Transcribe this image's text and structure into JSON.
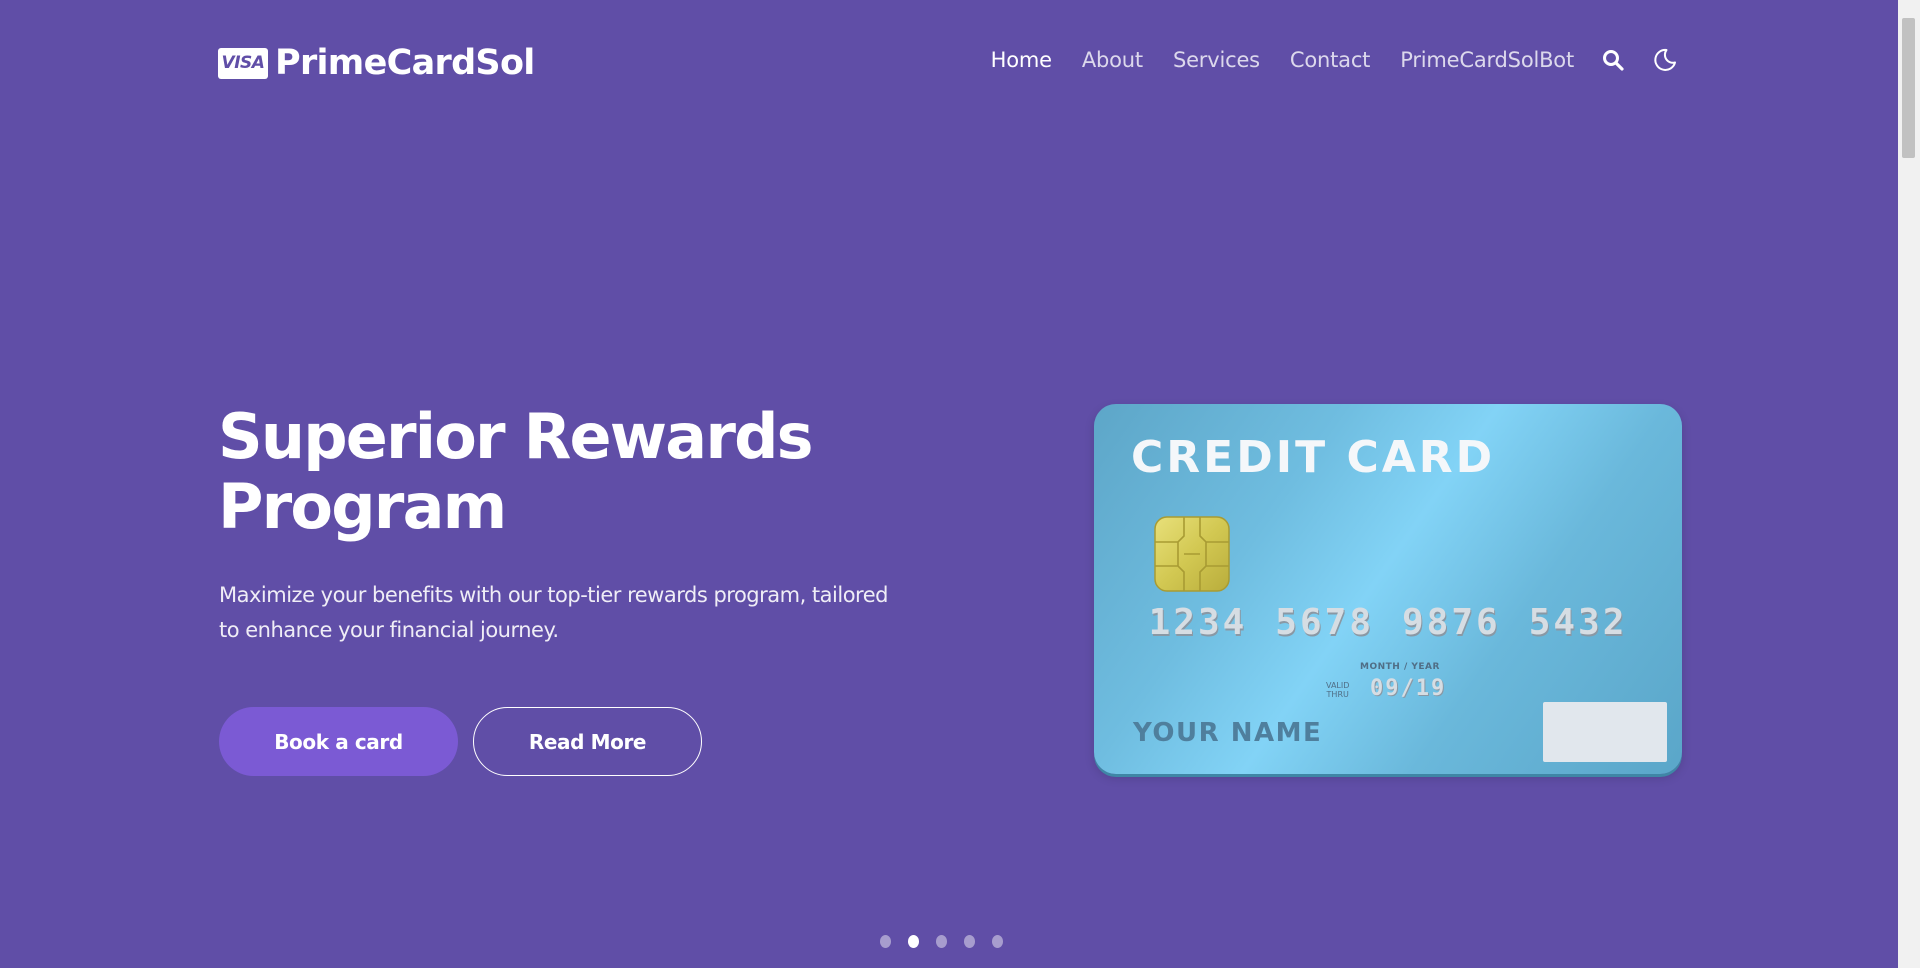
{
  "brand": {
    "badge_text": "VISA",
    "name": "PrimeCardSol"
  },
  "nav": {
    "links": [
      "Home",
      "About",
      "Services",
      "Contact",
      "PrimeCardSolBot"
    ],
    "active": "Home",
    "icons": [
      "search-icon",
      "moon-icon"
    ]
  },
  "hero": {
    "title_line1": "Superior Rewards",
    "title_line2": "Program",
    "text_line1": "Maximize your benefits with our top-tier rewards program, tailored",
    "text_line2": "to enhance your financial journey.",
    "primary_button": "Book a card",
    "secondary_button": "Read More"
  },
  "card": {
    "title": "CREDIT CARD",
    "number_groups": [
      "1234",
      "5678",
      "9876",
      "5432"
    ],
    "month_year_label": "MONTH / YEAR",
    "valid_line1": "VALID",
    "valid_line2": "THRU",
    "expiry": "09/19",
    "holder": "YOUR NAME"
  },
  "carousel": {
    "slide_count": 5,
    "active_index": 1
  },
  "colors": {
    "background": "#604ea7",
    "primary_button": "#7b5ad4",
    "card_blue": "#82d3f6",
    "chip_gold": "#d9cf5a"
  }
}
